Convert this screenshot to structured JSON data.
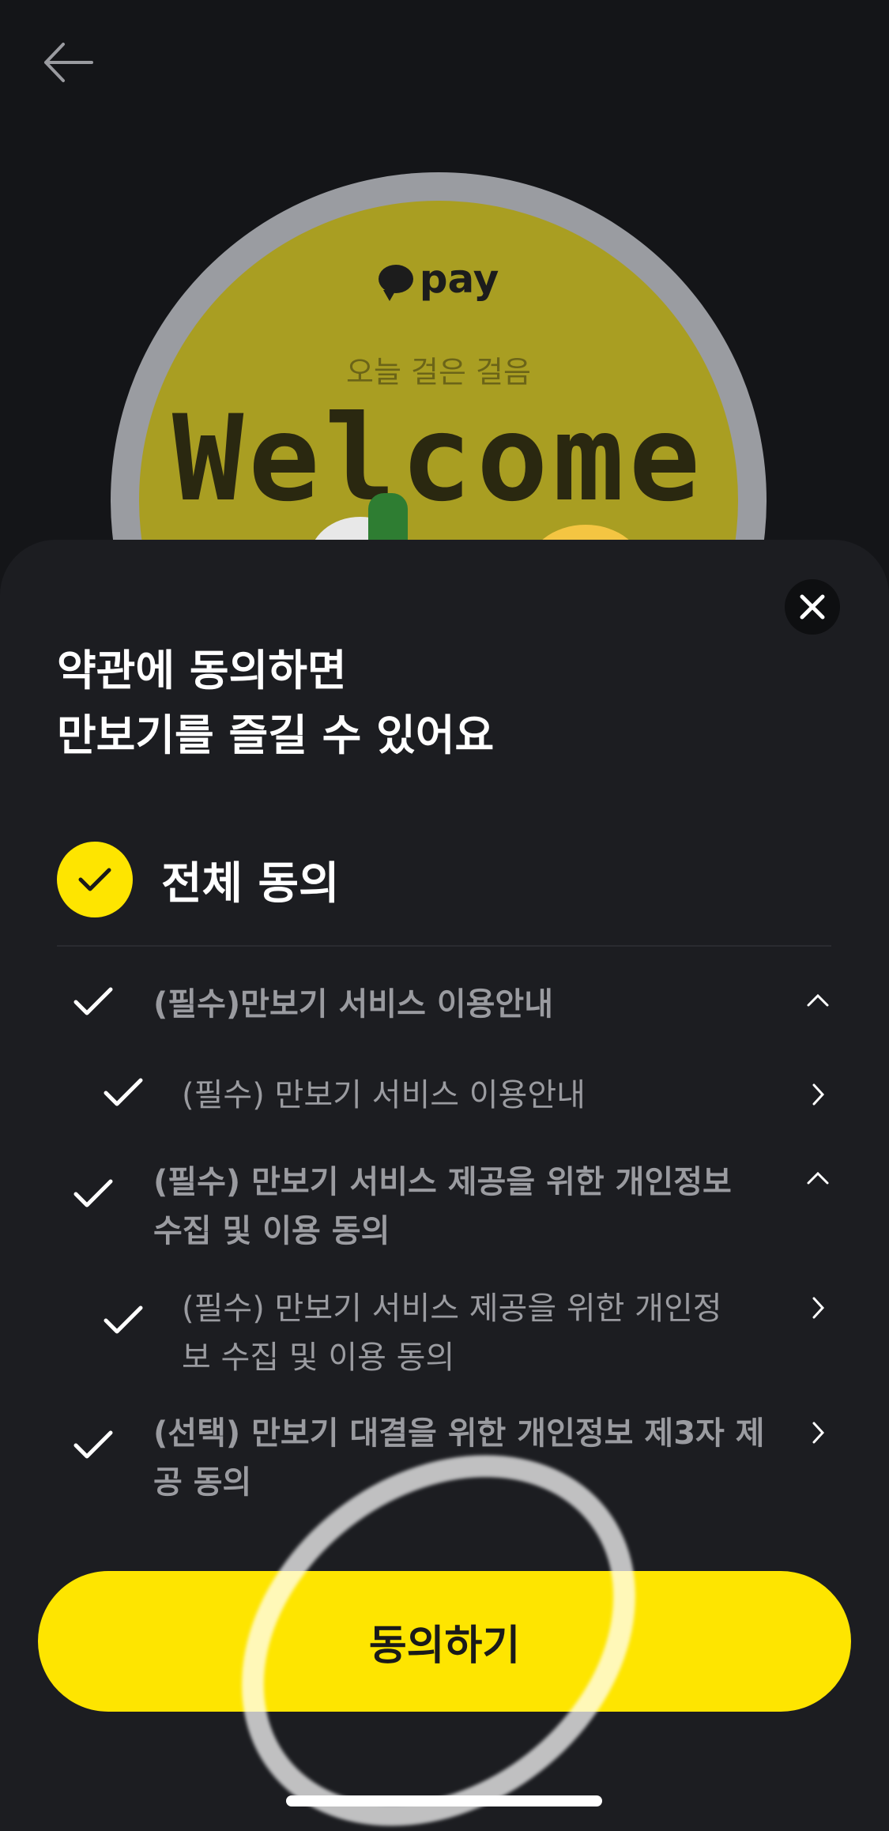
{
  "header": {
    "back_icon": "arrow-left-icon"
  },
  "badge": {
    "logo_text": "pay",
    "subtitle": "오늘 걸은 걸음",
    "welcome": "Welcome"
  },
  "sheet": {
    "close_icon": "close-icon",
    "title_line1": "약관에 동의하면",
    "title_line2": "만보기를 즐길 수 있어요",
    "all_agree_label": "전체 동의",
    "terms": [
      {
        "label": "(필수)만보기 서비스 이용안내",
        "level": "main",
        "indicator": "chevron-up-icon"
      },
      {
        "label": "(필수) 만보기 서비스 이용안내",
        "level": "sub",
        "indicator": "chevron-right-icon"
      },
      {
        "label": "(필수) 만보기 서비스 제공을 위한 개인정보 수집 및 이용 동의",
        "level": "main",
        "indicator": "chevron-up-icon"
      },
      {
        "label": "(필수) 만보기 서비스 제공을 위한 개인정보 수집 및 이용 동의",
        "level": "sub",
        "indicator": "chevron-right-icon"
      },
      {
        "label": "(선택) 만보기 대결을 위한 개인정보 제3자 제공 동의",
        "level": "main",
        "indicator": "chevron-right-icon"
      }
    ],
    "agree_button": "동의하기"
  },
  "colors": {
    "accent": "#fee500",
    "background": "#141518",
    "sheet": "#1c1d21"
  }
}
